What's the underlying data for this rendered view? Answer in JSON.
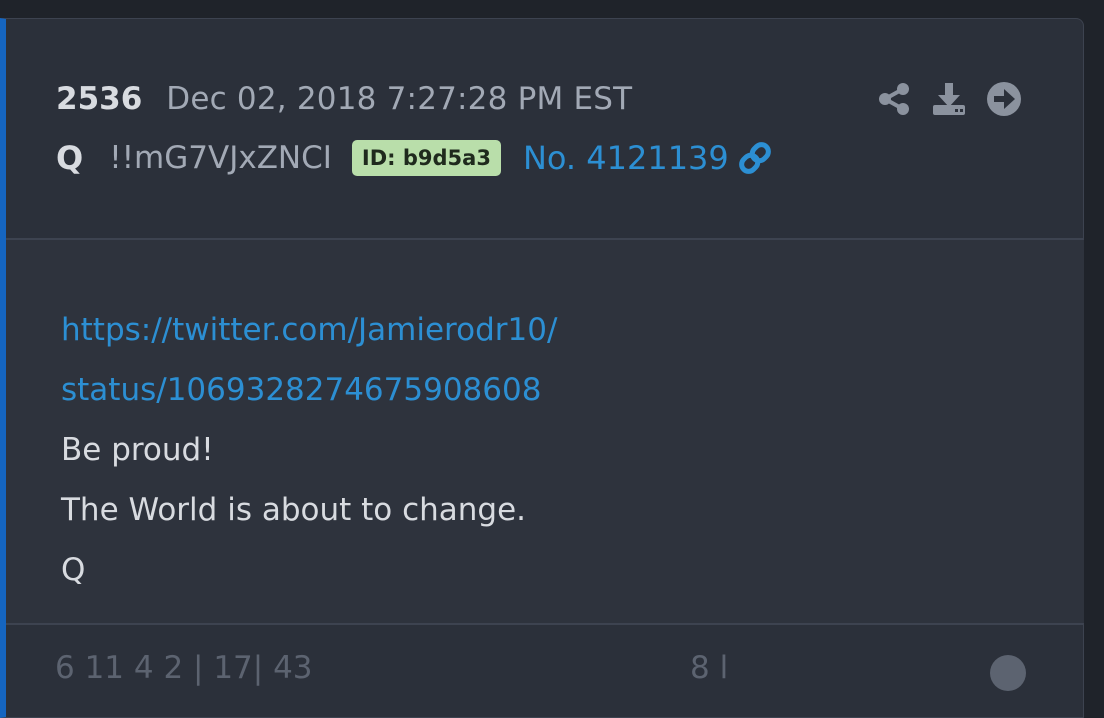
{
  "post": {
    "number": "2536",
    "date": "Dec 02, 2018 7:27:28 PM EST",
    "author": "Q",
    "tripcode": "!!mG7VJxZNCI",
    "id_badge": "ID: b9d5a3",
    "post_no": "No. 4121139",
    "link_line1": "https://twitter.com/Jamierodr10/",
    "link_line2": "status/1069328274675908608",
    "body_lines": [
      "Be proud!",
      "The World is about to change.",
      "Q"
    ]
  },
  "footer": {
    "left_text": "6   11    4    2 | 17|  43",
    "right_text": "8  l           "
  },
  "colors": {
    "accent_bar": "#1565c0",
    "link": "#2c8fd3",
    "id_badge_bg": "#b9deaa"
  },
  "icons": [
    "share-icon",
    "download-icon",
    "arrow-right-circle-icon",
    "link-icon"
  ]
}
